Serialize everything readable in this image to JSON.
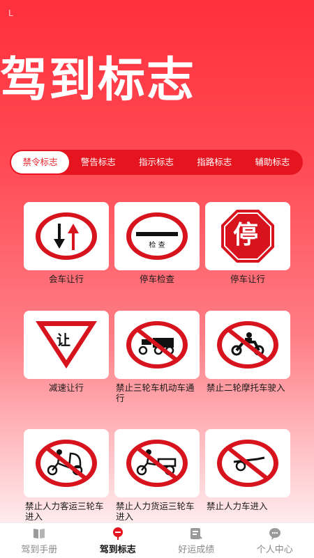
{
  "status": {
    "mark": "L"
  },
  "hero": {
    "title": "驾到标志"
  },
  "tabs": [
    {
      "label": "禁令标志",
      "active": true
    },
    {
      "label": "警告标志",
      "active": false
    },
    {
      "label": "指示标志",
      "active": false
    },
    {
      "label": "指路标志",
      "active": false
    },
    {
      "label": "辅助标志",
      "active": false
    }
  ],
  "signs": [
    {
      "label": "会车让行"
    },
    {
      "label": "停车检查",
      "sign_text": "检 查"
    },
    {
      "label": "停车让行",
      "sign_text": "停"
    },
    {
      "label": "减速让行",
      "sign_text": "让"
    },
    {
      "label": "禁止三轮车机动车通行"
    },
    {
      "label": "禁止二轮摩托车驶入"
    },
    {
      "label": "禁止人力客运三轮车进入"
    },
    {
      "label": "禁止人力货运三轮车进入"
    },
    {
      "label": "禁止人力车进入"
    }
  ],
  "bottom_nav": [
    {
      "label": "驾到手册",
      "icon": "book-icon",
      "active": false
    },
    {
      "label": "驾到标志",
      "icon": "sign-post-icon",
      "active": true
    },
    {
      "label": "好运成绩",
      "icon": "score-card-icon",
      "active": false
    },
    {
      "label": "个人中心",
      "icon": "chat-bubble-icon",
      "active": false
    }
  ],
  "colors": {
    "accent": "#e5141f",
    "sign_red": "#d7141e"
  }
}
